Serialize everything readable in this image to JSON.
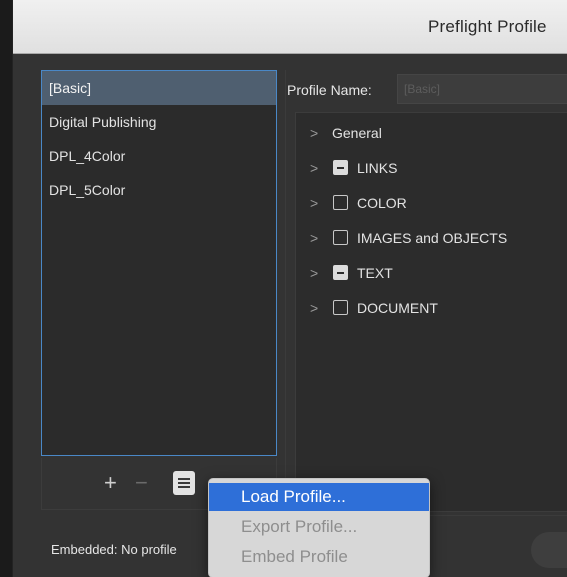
{
  "window": {
    "title": "Preflight Profile"
  },
  "profiles": {
    "items": [
      {
        "label": "[Basic]",
        "selected": true
      },
      {
        "label": "Digital Publishing",
        "selected": false
      },
      {
        "label": "DPL_4Color",
        "selected": false
      },
      {
        "label": "DPL_5Color",
        "selected": false
      }
    ]
  },
  "list_toolbar": {
    "add_symbol": "+",
    "remove_symbol": "−",
    "menu_icon": "menu-icon"
  },
  "profile_name": {
    "label": "Profile Name:",
    "value": "[Basic]"
  },
  "categories": [
    {
      "label": "General",
      "checkbox": "none"
    },
    {
      "label": "LINKS",
      "checkbox": "mixed"
    },
    {
      "label": "COLOR",
      "checkbox": "unchecked"
    },
    {
      "label": "IMAGES and OBJECTS",
      "checkbox": "unchecked"
    },
    {
      "label": "TEXT",
      "checkbox": "mixed"
    },
    {
      "label": "DOCUMENT",
      "checkbox": "unchecked"
    }
  ],
  "footer": {
    "embedded_text": "Embedded: No profile"
  },
  "context_menu": {
    "items": [
      {
        "label": "Load Profile...",
        "state": "highlighted"
      },
      {
        "label": "Export Profile...",
        "state": "disabled"
      },
      {
        "label": "Embed Profile",
        "state": "disabled"
      }
    ]
  },
  "colors": {
    "accent": "#4a88c7",
    "menu_highlight": "#2e6fd8",
    "selection": "#4f5f70"
  }
}
